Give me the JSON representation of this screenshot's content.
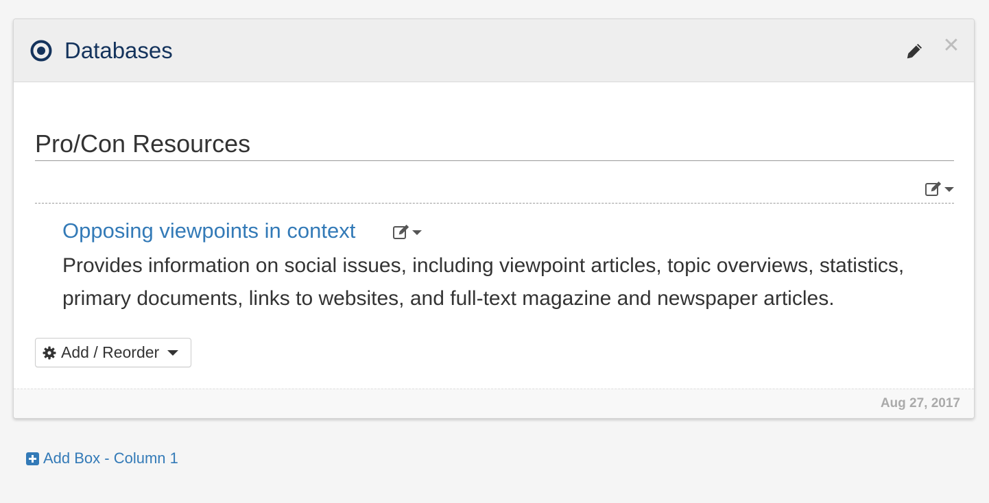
{
  "box": {
    "title": "Databases",
    "icon": "target-icon",
    "section_heading": "Pro/Con Resources",
    "asset": {
      "link_text": "Opposing viewpoints in context",
      "description": "Provides information on social issues, including viewpoint articles, topic overviews, statistics, primary documents, links to websites, and full-text magazine and newspaper articles."
    },
    "add_reorder_label": "Add / Reorder",
    "footer_date": "Aug 27, 2017"
  },
  "add_box_label": "Add Box - Column 1",
  "colors": {
    "title": "#14335c",
    "link": "#337ab7",
    "header_bg": "#eeeeee"
  }
}
